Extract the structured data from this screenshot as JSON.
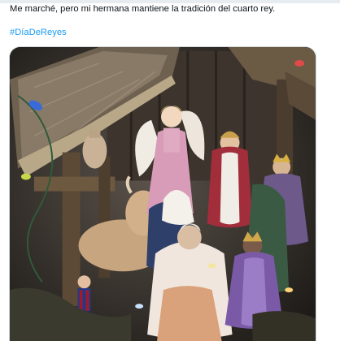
{
  "tweet": {
    "text": "Me marché, pero mi hermana mantiene la tradición del cuarto rey.",
    "hashtag": "#DíaDeReyes"
  },
  "media": {
    "description": "Belén navideño con figuras de la Virgen, un ángel, los Reyes Magos, un buey y un muñeco de futbolista"
  },
  "colors": {
    "text": "#0f1419",
    "link": "#1d9bf0",
    "border": "#cfd9de"
  }
}
